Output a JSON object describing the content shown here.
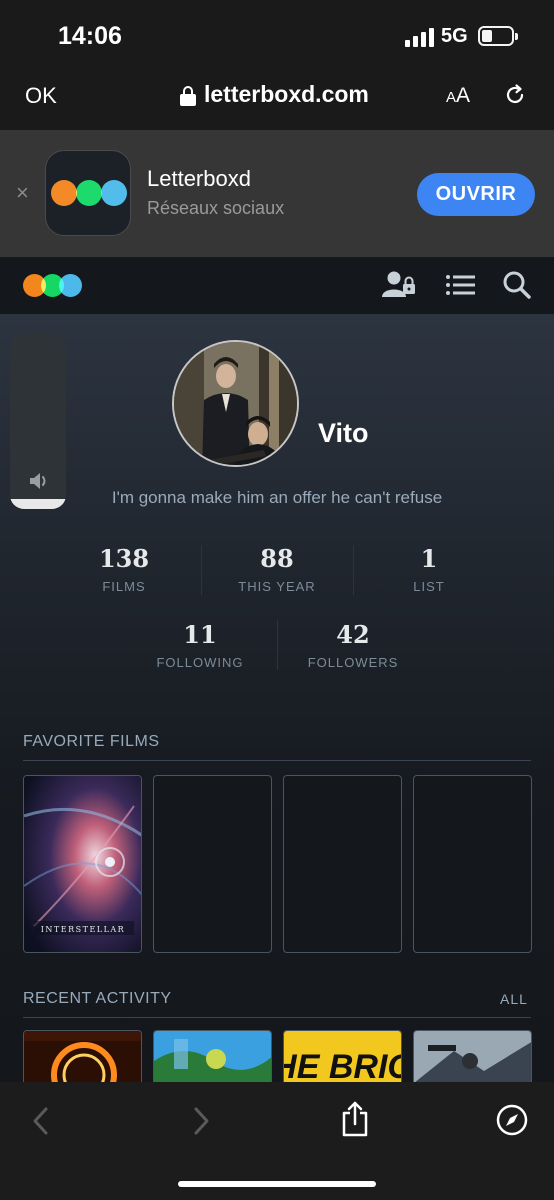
{
  "status_bar": {
    "time": "14:06",
    "network": "5G",
    "battery_icon": "battery-low-icon"
  },
  "browser": {
    "done_label": "OK",
    "url": "letterboxd.com",
    "text_size_small": "A",
    "text_size_big": "A"
  },
  "app_banner": {
    "app_name": "Letterboxd",
    "category": "Réseaux sociaux",
    "open_label": "OUVRIR",
    "close_glyph": "×"
  },
  "brand_colors": {
    "orange": "#ff8000",
    "green": "#00e054",
    "blue": "#40bcf4",
    "open_button": "#3c85f3"
  },
  "profile": {
    "username": "Vito",
    "bio": "I'm gonna make him an offer he can't refuse",
    "stats": [
      {
        "value": "138",
        "label": "FILMS"
      },
      {
        "value": "88",
        "label": "THIS YEAR"
      },
      {
        "value": "1",
        "label": "LIST"
      }
    ],
    "social": [
      {
        "value": "11",
        "label": "FOLLOWING"
      },
      {
        "value": "42",
        "label": "FOLLOWERS"
      }
    ]
  },
  "favorites": {
    "title": "FAVORITE FILMS",
    "first_poster_text": "INTERSTELLAR"
  },
  "recent_activity": {
    "title": "RECENT ACTIVITY",
    "all_label": "ALL",
    "third_poster_text": "THE BRICE"
  }
}
